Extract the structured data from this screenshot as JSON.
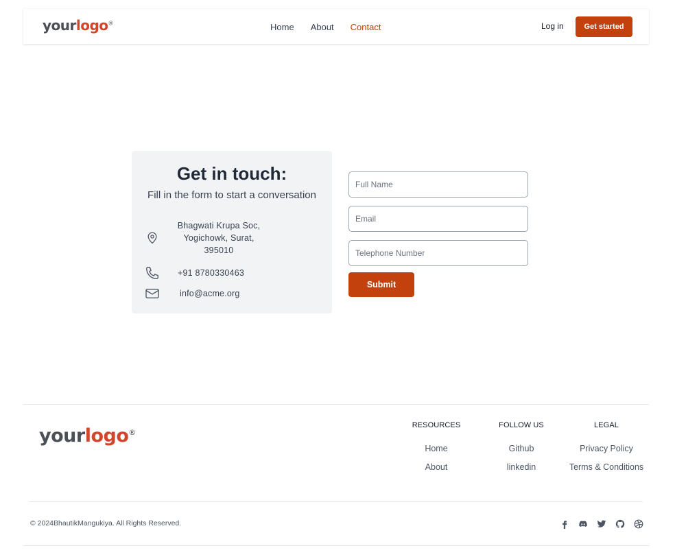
{
  "header": {
    "logo": {
      "word1": "your",
      "word2": "logo",
      "mark": "®"
    },
    "nav": [
      {
        "label": "Home",
        "active": false
      },
      {
        "label": "About",
        "active": false
      },
      {
        "label": "Contact",
        "active": true
      }
    ],
    "login_label": "Log in",
    "cta_label": "Get started"
  },
  "contact": {
    "title": "Get in touch:",
    "subtitle": "Fill in the form to start a conversation",
    "address_lines": [
      "Bhagwati Krupa Soc,",
      "Yogichowk, Surat,",
      "395010"
    ],
    "phone": "+91 8780330463",
    "email": "info@acme.org",
    "icons": {
      "address": "map-pin-icon",
      "phone": "phone-icon",
      "email": "mail-icon"
    }
  },
  "form": {
    "full_name_placeholder": "Full Name",
    "email_placeholder": "Email",
    "phone_placeholder": "Telephone Number",
    "submit_label": "Submit"
  },
  "footer": {
    "logo": {
      "word1": "your",
      "word2": "logo",
      "mark": "®"
    },
    "columns": [
      {
        "title": "RESOURCES",
        "links": [
          "Home",
          "About"
        ]
      },
      {
        "title": "FOLLOW US",
        "links": [
          "Github",
          "linkedin"
        ]
      },
      {
        "title": "LEGAL",
        "links": [
          "Privacy Policy",
          "Terms & Conditions"
        ]
      }
    ],
    "copyright": "© 2024BhautikMangukiya. All Rights Reserved.",
    "socials": [
      "facebook-icon",
      "discord-icon",
      "twitter-icon",
      "github-icon",
      "dribbble-icon"
    ]
  },
  "colors": {
    "accent": "#c2410c",
    "logo_accent": "#d0462b",
    "card_bg": "#f2f3f5"
  }
}
